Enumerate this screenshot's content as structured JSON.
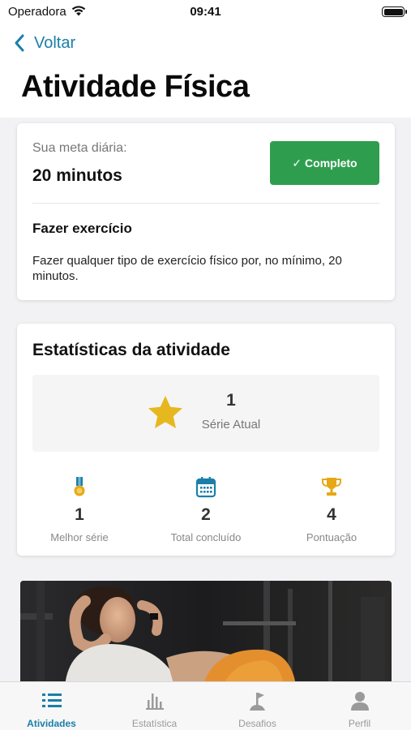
{
  "status_bar": {
    "carrier": "Operadora",
    "time": "09:41",
    "icons": [
      "wifi-icon",
      "battery-icon"
    ]
  },
  "nav": {
    "back_label": "Voltar"
  },
  "page": {
    "title": "Atividade Física"
  },
  "goal": {
    "label": "Sua meta diária:",
    "value": "20 minutos",
    "complete_button": "✓ Completo",
    "task_title": "Fazer exercício",
    "task_description": "Fazer qualquer tipo de exercício físico por, no mínimo, 20 minutos."
  },
  "stats": {
    "title": "Estatísticas da atividade",
    "streak": {
      "value": "1",
      "label": "Série Atual",
      "icon": "star-icon"
    },
    "items": [
      {
        "value": "1",
        "label": "Melhor série",
        "icon": "medal-icon"
      },
      {
        "value": "2",
        "label": "Total concluído",
        "icon": "calendar-icon"
      },
      {
        "value": "4",
        "label": "Pontuação",
        "icon": "trophy-icon"
      }
    ]
  },
  "tabs": [
    {
      "label": "Atividades",
      "icon": "list-icon",
      "active": true
    },
    {
      "label": "Estatística",
      "icon": "bar-chart-icon",
      "active": false
    },
    {
      "label": "Desafios",
      "icon": "flag-icon",
      "active": false
    },
    {
      "label": "Perfil",
      "icon": "person-icon",
      "active": false
    }
  ],
  "colors": {
    "accent": "#1a7fa8",
    "success": "#2e9e4e",
    "star": "#e6b820",
    "stat_icon_blue": "#1a7fa8",
    "stat_icon_gold": "#e6a817",
    "tab_inactive": "#9a9a9a"
  }
}
